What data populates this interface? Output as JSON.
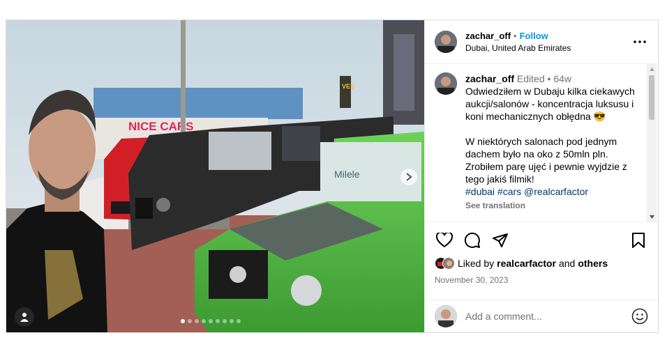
{
  "post": {
    "header": {
      "username": "zachar_off",
      "follow_label": "Follow",
      "separator": "•",
      "location": "Dubai, United Arab Emirates"
    },
    "media": {
      "sign_text": "NICE CARS",
      "tower_text": "VES",
      "door_text": "Milele",
      "carousel_count": 9,
      "carousel_active": 1
    },
    "caption": {
      "username": "zachar_off",
      "edited": "Edited",
      "bullet": "•",
      "age": "64w",
      "text": "Odwiedziłem w Dubaju kilka ciekawych aukcji/salonów - koncentracja luksusu i koni mechanicznych obłędna 😎\n\nW niektórych salonach pod jednym dachem było na oko z 50mln pln. Zrobiłem parę ujęć i pewnie wyjdzie z tego jakiś filmik!",
      "hashtags": "#dubai #cars @realcarfactor",
      "see_translation": "See translation"
    },
    "likes": {
      "prefix": "Liked by",
      "user": "realcarfactor",
      "middle": "and",
      "others": "others"
    },
    "date": "November 30, 2023",
    "comment_placeholder": "Add a comment..."
  },
  "colors": {
    "link": "#0095f6",
    "hashtag": "#00376b",
    "muted": "#737373",
    "green_car": "#5cbb4a",
    "red_car": "#d21f26",
    "black_car": "#2b2b2b"
  }
}
